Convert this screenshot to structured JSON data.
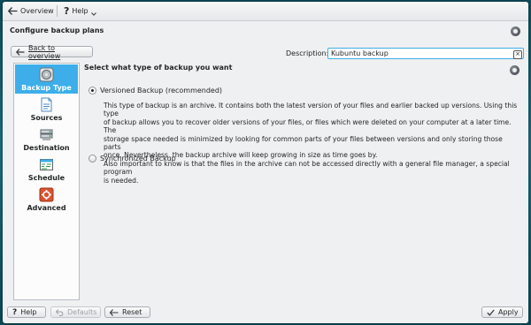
{
  "toolbar": {
    "overview_label": "Overview",
    "help_label": "Help"
  },
  "page": {
    "title": "Configure backup plans"
  },
  "back_button": {
    "label": "Back to overview"
  },
  "description": {
    "label": "Description:",
    "value": "Kubuntu backup"
  },
  "sidebar": {
    "items": [
      {
        "label": "Backup Type",
        "icon": "backup-type-icon",
        "active": true
      },
      {
        "label": "Sources",
        "icon": "sources-icon",
        "active": false
      },
      {
        "label": "Destination",
        "icon": "destination-icon",
        "active": false
      },
      {
        "label": "Schedule",
        "icon": "schedule-icon",
        "active": false
      },
      {
        "label": "Advanced",
        "icon": "advanced-icon",
        "active": false
      }
    ]
  },
  "main": {
    "heading": "Select what type of backup you want",
    "options": [
      {
        "label": "Versioned Backup (recommended)",
        "selected": true
      },
      {
        "label": "Synchronized Backup",
        "selected": false
      }
    ],
    "explanation": [
      "This type of backup is an archive. It contains both the latest version of your files and earlier backed up versions. Using this type",
      "of backup allows you to recover older versions of your files, or files which were deleted on your computer at a later time. The",
      "storage space needed is minimized by looking for common parts of your files between versions and only storing those parts",
      "once. Nevertheless, the backup archive will keep growing in size as time goes by.",
      "Also important to know is that the files in the archive can not be accessed directly with a general file manager, a special program",
      "is needed."
    ]
  },
  "buttons": {
    "help": "Help",
    "defaults": "Defaults",
    "reset": "Reset",
    "apply": "Apply"
  },
  "colors": {
    "accent": "#3daee9",
    "window": "#eff0f1",
    "sidebar_bg": "#fcfcfc"
  }
}
